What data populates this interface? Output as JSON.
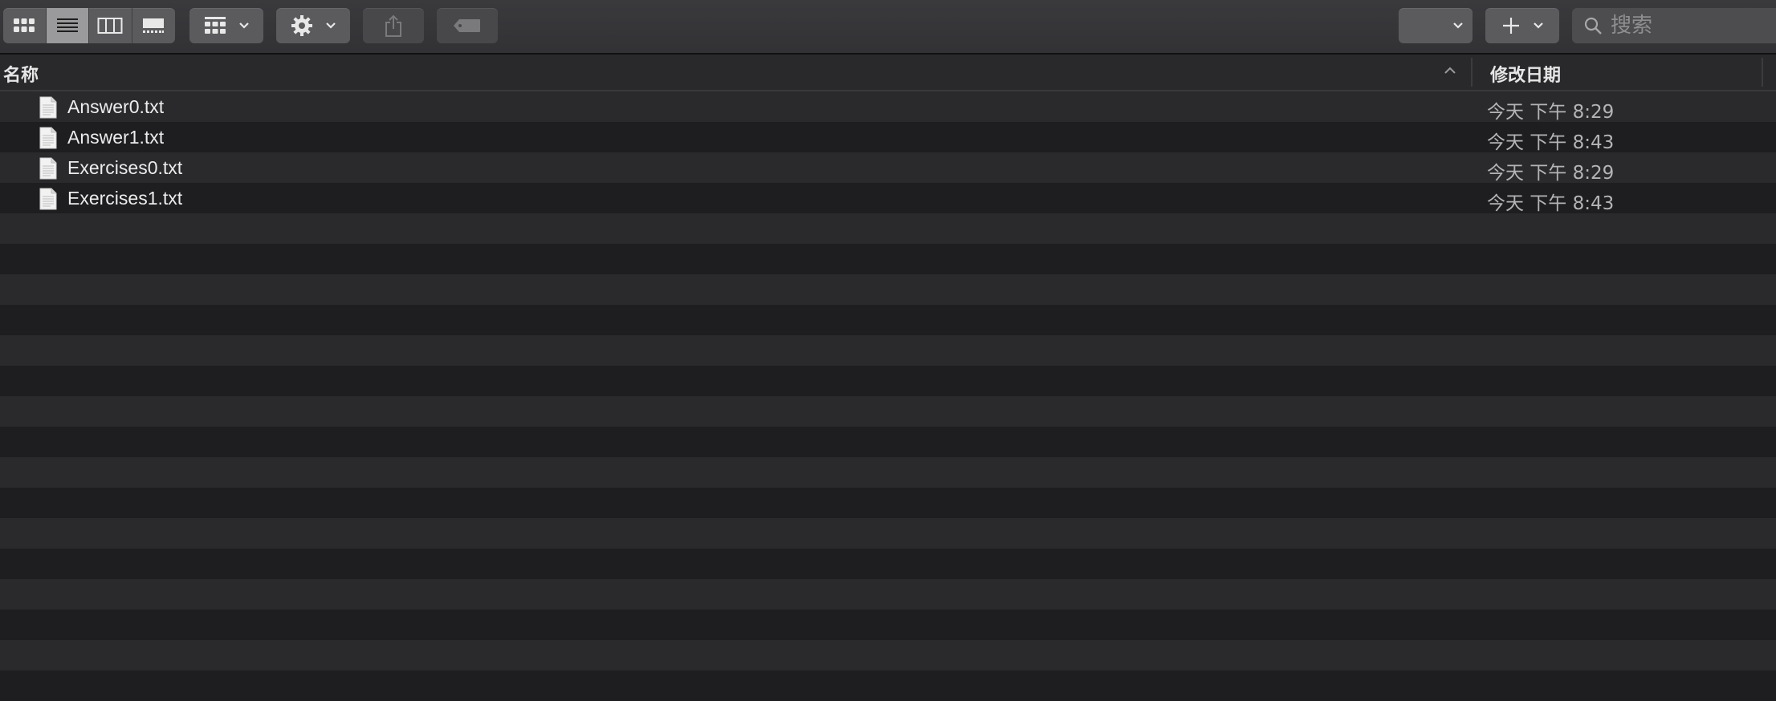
{
  "toolbar": {
    "view_modes": [
      "icon-view",
      "list-view",
      "column-view",
      "gallery-view"
    ],
    "active_view": "list-view",
    "sort_icon": "group-grid-icon",
    "action_icon": "gear-icon",
    "share_icon": "share-icon",
    "tag_icon": "tag-icon",
    "group_value": "",
    "add_label": "+",
    "search_placeholder": "搜索"
  },
  "columns": {
    "name": "名称",
    "date_modified": "修改日期"
  },
  "files": [
    {
      "name": "Answer0.txt",
      "date": "今天 下午 8:29",
      "icon": "text-file-icon"
    },
    {
      "name": "Answer1.txt",
      "date": "今天 下午 8:43",
      "icon": "text-file-icon"
    },
    {
      "name": "Exercises0.txt",
      "date": "今天 下午 8:29",
      "icon": "text-file-icon"
    },
    {
      "name": "Exercises1.txt",
      "date": "今天 下午 8:43",
      "icon": "text-file-icon"
    }
  ],
  "colors": {
    "toolbar_bg": "#343437",
    "row_odd": "#2a2a2d",
    "row_even": "#1e1e21",
    "text": "#ececec",
    "date_text": "#b4b4b6"
  }
}
